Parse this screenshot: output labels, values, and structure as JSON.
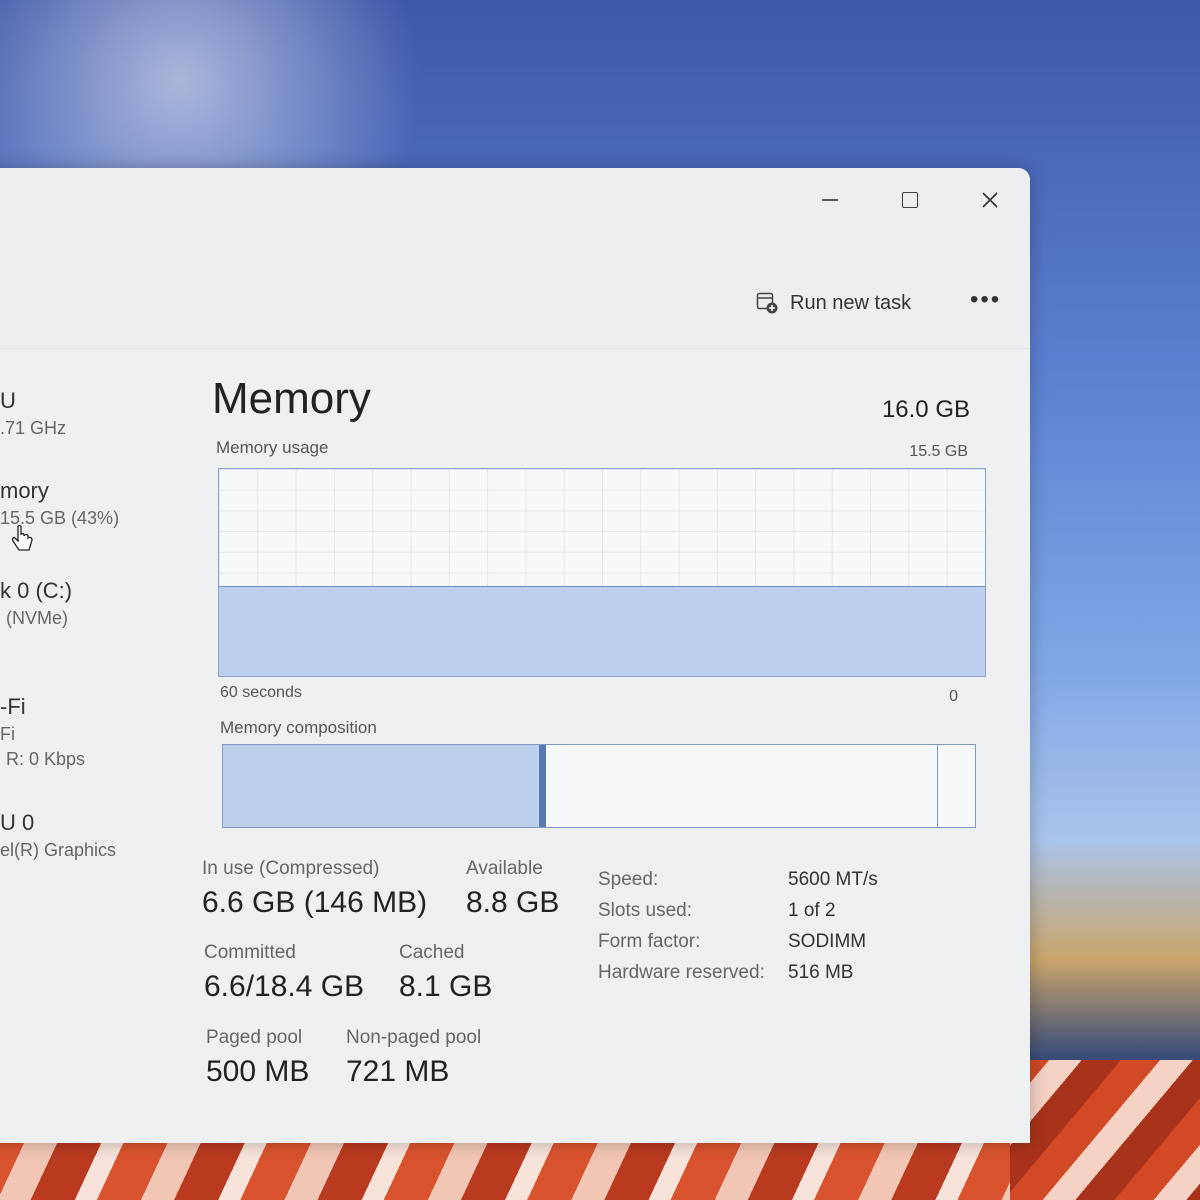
{
  "window": {
    "controls": {
      "minimize_label": "—",
      "maximize_label": "□",
      "close_label": "✕"
    }
  },
  "toolbar": {
    "run_new_task": "Run new task",
    "more_label": "•••"
  },
  "sidebar": {
    "items": [
      {
        "title": "U",
        "sub": ".71 GHz",
        "sub2": ""
      },
      {
        "title": "mory",
        "sub": "15.5 GB (43%)",
        "sub2": ""
      },
      {
        "title": "k 0 (C:)",
        "sub": "(NVMe)",
        "sub2": ""
      },
      {
        "title": "-Fi",
        "sub": "Fi",
        "sub2": "R: 0 Kbps"
      },
      {
        "title": "U 0",
        "sub": "el(R) Graphics",
        "sub2": ""
      }
    ]
  },
  "memory": {
    "title": "Memory",
    "total": "16.0 GB",
    "usage_label": "Memory usage",
    "usage_max": "15.5 GB",
    "axis_left": "60 seconds",
    "axis_right": "0",
    "composition_label": "Memory composition",
    "usage_fraction": 0.43,
    "composition": {
      "in_use_fraction": 0.42,
      "modified_fraction": 0.01,
      "standby_fraction": 0.52,
      "free_fraction": 0.05
    },
    "stats": {
      "in_use_label": "In use (Compressed)",
      "in_use_value": "6.6 GB (146 MB)",
      "available_label": "Available",
      "available_value": "8.8 GB",
      "committed_label": "Committed",
      "committed_value": "6.6/18.4 GB",
      "cached_label": "Cached",
      "cached_value": "8.1 GB",
      "paged_label": "Paged pool",
      "paged_value": "500 MB",
      "nonpaged_label": "Non-paged pool",
      "nonpaged_value": "721 MB"
    },
    "specs": [
      {
        "key": "Speed:",
        "value": "5600 MT/s"
      },
      {
        "key": "Slots used:",
        "value": "1 of 2"
      },
      {
        "key": "Form factor:",
        "value": "SODIMM"
      },
      {
        "key": "Hardware reserved:",
        "value": "516 MB"
      }
    ]
  },
  "colors": {
    "graph_fill": "#bcd0ee",
    "graph_line": "#6f8fc7",
    "border": "#8aa0c8"
  }
}
